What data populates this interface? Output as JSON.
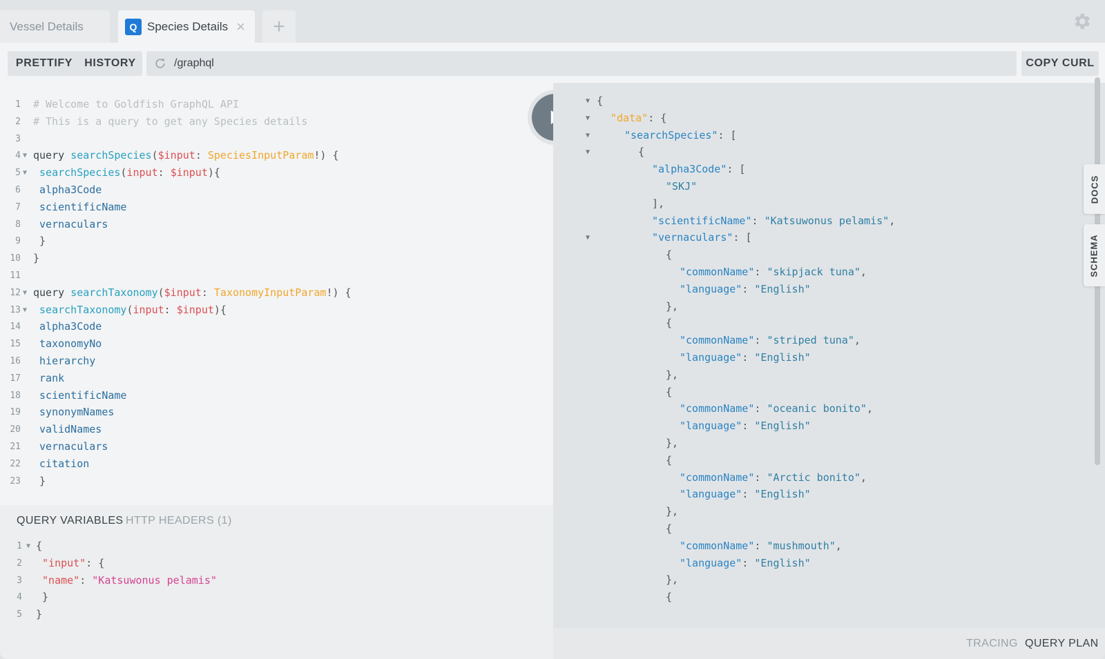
{
  "tabs": [
    {
      "label": "Vessel Details",
      "active": false
    },
    {
      "label": "Species Details",
      "active": true,
      "badge": "Q"
    }
  ],
  "toolbar": {
    "prettify": "PRETTIFY",
    "history": "HISTORY",
    "url": "/graphql",
    "copy_curl": "COPY CURL"
  },
  "editor": {
    "lines": [
      {
        "n": "1",
        "fold": false,
        "tokens": [
          {
            "t": "# Welcome to Goldfish GraphQL API",
            "c": "comment"
          }
        ]
      },
      {
        "n": "2",
        "fold": false,
        "tokens": [
          {
            "t": "# This is a query to get any Species details",
            "c": "comment"
          }
        ]
      },
      {
        "n": "3",
        "fold": false,
        "tokens": []
      },
      {
        "n": "4",
        "fold": true,
        "tokens": [
          {
            "t": "query ",
            "c": "kw"
          },
          {
            "t": "searchSpecies",
            "c": "fn"
          },
          {
            "t": "(",
            "c": "plain"
          },
          {
            "t": "$input",
            "c": "var"
          },
          {
            "t": ": ",
            "c": "plain"
          },
          {
            "t": "SpeciesInputParam",
            "c": "type"
          },
          {
            "t": "!) {",
            "c": "plain"
          }
        ]
      },
      {
        "n": "5",
        "fold": true,
        "tokens": [
          {
            "t": " searchSpecies",
            "c": "fn"
          },
          {
            "t": "(",
            "c": "plain"
          },
          {
            "t": "input",
            "c": "var"
          },
          {
            "t": ": ",
            "c": "plain"
          },
          {
            "t": "$input",
            "c": "var"
          },
          {
            "t": "){",
            "c": "plain"
          }
        ]
      },
      {
        "n": "6",
        "fold": false,
        "tokens": [
          {
            "t": " alpha3Code",
            "c": "field"
          }
        ]
      },
      {
        "n": "7",
        "fold": false,
        "tokens": [
          {
            "t": " scientificName",
            "c": "field"
          }
        ]
      },
      {
        "n": "8",
        "fold": false,
        "tokens": [
          {
            "t": " vernaculars",
            "c": "field"
          }
        ]
      },
      {
        "n": "9",
        "fold": false,
        "tokens": [
          {
            "t": " }",
            "c": "plain"
          }
        ]
      },
      {
        "n": "10",
        "fold": false,
        "tokens": [
          {
            "t": "}",
            "c": "plain"
          }
        ]
      },
      {
        "n": "11",
        "fold": false,
        "tokens": []
      },
      {
        "n": "12",
        "fold": true,
        "tokens": [
          {
            "t": "query ",
            "c": "kw"
          },
          {
            "t": "searchTaxonomy",
            "c": "fn"
          },
          {
            "t": "(",
            "c": "plain"
          },
          {
            "t": "$input",
            "c": "var"
          },
          {
            "t": ": ",
            "c": "plain"
          },
          {
            "t": "TaxonomyInputParam",
            "c": "type"
          },
          {
            "t": "!) {",
            "c": "plain"
          }
        ]
      },
      {
        "n": "13",
        "fold": true,
        "tokens": [
          {
            "t": " searchTaxonomy",
            "c": "fn"
          },
          {
            "t": "(",
            "c": "plain"
          },
          {
            "t": "input",
            "c": "var"
          },
          {
            "t": ": ",
            "c": "plain"
          },
          {
            "t": "$input",
            "c": "var"
          },
          {
            "t": "){",
            "c": "plain"
          }
        ]
      },
      {
        "n": "14",
        "fold": false,
        "tokens": [
          {
            "t": " alpha3Code",
            "c": "field"
          }
        ]
      },
      {
        "n": "15",
        "fold": false,
        "tokens": [
          {
            "t": " taxonomyNo",
            "c": "field"
          }
        ]
      },
      {
        "n": "16",
        "fold": false,
        "tokens": [
          {
            "t": " hierarchy",
            "c": "field"
          }
        ]
      },
      {
        "n": "17",
        "fold": false,
        "tokens": [
          {
            "t": " rank",
            "c": "field"
          }
        ]
      },
      {
        "n": "18",
        "fold": false,
        "tokens": [
          {
            "t": " scientificName",
            "c": "field"
          }
        ]
      },
      {
        "n": "19",
        "fold": false,
        "tokens": [
          {
            "t": " synonymNames",
            "c": "field"
          }
        ]
      },
      {
        "n": "20",
        "fold": false,
        "tokens": [
          {
            "t": " validNames",
            "c": "field"
          }
        ]
      },
      {
        "n": "21",
        "fold": false,
        "tokens": [
          {
            "t": " vernaculars",
            "c": "field"
          }
        ]
      },
      {
        "n": "22",
        "fold": false,
        "tokens": [
          {
            "t": " citation",
            "c": "field"
          }
        ]
      },
      {
        "n": "23",
        "fold": false,
        "tokens": [
          {
            "t": " }",
            "c": "plain"
          }
        ]
      }
    ]
  },
  "variables_pane": {
    "tab_active": "QUERY VARIABLES",
    "tab_inactive": "HTTP HEADERS (1)",
    "lines": [
      {
        "n": "1",
        "fold": true,
        "tokens": [
          {
            "t": "{",
            "c": "plain"
          }
        ]
      },
      {
        "n": "2",
        "fold": false,
        "tokens": [
          {
            "t": " \"input\"",
            "c": "key"
          },
          {
            "t": ": {",
            "c": "plain"
          }
        ]
      },
      {
        "n": "3",
        "fold": false,
        "tokens": [
          {
            "t": " \"name\"",
            "c": "key"
          },
          {
            "t": ": ",
            "c": "plain"
          },
          {
            "t": "\"Katsuwonus pelamis\"",
            "c": "str"
          }
        ]
      },
      {
        "n": "4",
        "fold": false,
        "tokens": [
          {
            "t": " }",
            "c": "plain"
          }
        ]
      },
      {
        "n": "5",
        "fold": false,
        "tokens": [
          {
            "t": "}",
            "c": "plain"
          }
        ]
      }
    ]
  },
  "result": {
    "lines": [
      {
        "indent": 0,
        "fold": true,
        "tokens": [
          {
            "t": "{",
            "c": "plain"
          }
        ]
      },
      {
        "indent": 1,
        "fold": true,
        "tokens": [
          {
            "t": "\"data\"",
            "c": "data"
          },
          {
            "t": ": {",
            "c": "plain"
          }
        ]
      },
      {
        "indent": 2,
        "fold": true,
        "tokens": [
          {
            "t": "\"searchSpecies\"",
            "c": "key"
          },
          {
            "t": ": [",
            "c": "plain"
          }
        ]
      },
      {
        "indent": 3,
        "fold": true,
        "tokens": [
          {
            "t": "{",
            "c": "plain"
          }
        ]
      },
      {
        "indent": 4,
        "fold": false,
        "tokens": [
          {
            "t": "\"alpha3Code\"",
            "c": "key"
          },
          {
            "t": ": [",
            "c": "plain"
          }
        ]
      },
      {
        "indent": 5,
        "fold": false,
        "tokens": [
          {
            "t": "\"SKJ\"",
            "c": "sval"
          }
        ]
      },
      {
        "indent": 4,
        "fold": false,
        "tokens": [
          {
            "t": "],",
            "c": "plain"
          }
        ]
      },
      {
        "indent": 4,
        "fold": false,
        "tokens": [
          {
            "t": "\"scientificName\"",
            "c": "key"
          },
          {
            "t": ": ",
            "c": "plain"
          },
          {
            "t": "\"Katsuwonus pelamis\"",
            "c": "sval"
          },
          {
            "t": ",",
            "c": "plain"
          }
        ]
      },
      {
        "indent": 4,
        "fold": true,
        "tokens": [
          {
            "t": "\"vernaculars\"",
            "c": "key"
          },
          {
            "t": ": [",
            "c": "plain"
          }
        ]
      },
      {
        "indent": 5,
        "fold": false,
        "tokens": [
          {
            "t": "{",
            "c": "plain"
          }
        ]
      },
      {
        "indent": 6,
        "fold": false,
        "tokens": [
          {
            "t": "\"commonName\"",
            "c": "key"
          },
          {
            "t": ": ",
            "c": "plain"
          },
          {
            "t": "\"skipjack tuna\"",
            "c": "sval"
          },
          {
            "t": ",",
            "c": "plain"
          }
        ]
      },
      {
        "indent": 6,
        "fold": false,
        "tokens": [
          {
            "t": "\"language\"",
            "c": "key"
          },
          {
            "t": ": ",
            "c": "plain"
          },
          {
            "t": "\"English\"",
            "c": "sval"
          }
        ]
      },
      {
        "indent": 5,
        "fold": false,
        "tokens": [
          {
            "t": "},",
            "c": "plain"
          }
        ]
      },
      {
        "indent": 5,
        "fold": false,
        "tokens": [
          {
            "t": "{",
            "c": "plain"
          }
        ]
      },
      {
        "indent": 6,
        "fold": false,
        "tokens": [
          {
            "t": "\"commonName\"",
            "c": "key"
          },
          {
            "t": ": ",
            "c": "plain"
          },
          {
            "t": "\"striped tuna\"",
            "c": "sval"
          },
          {
            "t": ",",
            "c": "plain"
          }
        ]
      },
      {
        "indent": 6,
        "fold": false,
        "tokens": [
          {
            "t": "\"language\"",
            "c": "key"
          },
          {
            "t": ": ",
            "c": "plain"
          },
          {
            "t": "\"English\"",
            "c": "sval"
          }
        ]
      },
      {
        "indent": 5,
        "fold": false,
        "tokens": [
          {
            "t": "},",
            "c": "plain"
          }
        ]
      },
      {
        "indent": 5,
        "fold": false,
        "tokens": [
          {
            "t": "{",
            "c": "plain"
          }
        ]
      },
      {
        "indent": 6,
        "fold": false,
        "tokens": [
          {
            "t": "\"commonName\"",
            "c": "key"
          },
          {
            "t": ": ",
            "c": "plain"
          },
          {
            "t": "\"oceanic bonito\"",
            "c": "sval"
          },
          {
            "t": ",",
            "c": "plain"
          }
        ]
      },
      {
        "indent": 6,
        "fold": false,
        "tokens": [
          {
            "t": "\"language\"",
            "c": "key"
          },
          {
            "t": ": ",
            "c": "plain"
          },
          {
            "t": "\"English\"",
            "c": "sval"
          }
        ]
      },
      {
        "indent": 5,
        "fold": false,
        "tokens": [
          {
            "t": "},",
            "c": "plain"
          }
        ]
      },
      {
        "indent": 5,
        "fold": false,
        "tokens": [
          {
            "t": "{",
            "c": "plain"
          }
        ]
      },
      {
        "indent": 6,
        "fold": false,
        "tokens": [
          {
            "t": "\"commonName\"",
            "c": "key"
          },
          {
            "t": ": ",
            "c": "plain"
          },
          {
            "t": "\"Arctic bonito\"",
            "c": "sval"
          },
          {
            "t": ",",
            "c": "plain"
          }
        ]
      },
      {
        "indent": 6,
        "fold": false,
        "tokens": [
          {
            "t": "\"language\"",
            "c": "key"
          },
          {
            "t": ": ",
            "c": "plain"
          },
          {
            "t": "\"English\"",
            "c": "sval"
          }
        ]
      },
      {
        "indent": 5,
        "fold": false,
        "tokens": [
          {
            "t": "},",
            "c": "plain"
          }
        ]
      },
      {
        "indent": 5,
        "fold": false,
        "tokens": [
          {
            "t": "{",
            "c": "plain"
          }
        ]
      },
      {
        "indent": 6,
        "fold": false,
        "tokens": [
          {
            "t": "\"commonName\"",
            "c": "key"
          },
          {
            "t": ": ",
            "c": "plain"
          },
          {
            "t": "\"mushmouth\"",
            "c": "sval"
          },
          {
            "t": ",",
            "c": "plain"
          }
        ]
      },
      {
        "indent": 6,
        "fold": false,
        "tokens": [
          {
            "t": "\"language\"",
            "c": "key"
          },
          {
            "t": ": ",
            "c": "plain"
          },
          {
            "t": "\"English\"",
            "c": "sval"
          }
        ]
      },
      {
        "indent": 5,
        "fold": false,
        "tokens": [
          {
            "t": "},",
            "c": "plain"
          }
        ]
      },
      {
        "indent": 5,
        "fold": false,
        "tokens": [
          {
            "t": "{",
            "c": "plain"
          }
        ]
      }
    ]
  },
  "side_tabs": {
    "docs": "DOCS",
    "schema": "SCHEMA"
  },
  "footer": {
    "tracing": "TRACING",
    "query_plan": "QUERY PLAN"
  },
  "icons": {
    "settings": "gear-icon",
    "play": "play-icon",
    "refresh": "refresh-icon",
    "close": "close-icon",
    "add": "plus-icon"
  },
  "colors": {
    "accent": "#1f7bd6",
    "play_button": "#6f7c85",
    "string_value": "#2f7fa3",
    "data_key": "#f0a62c"
  }
}
